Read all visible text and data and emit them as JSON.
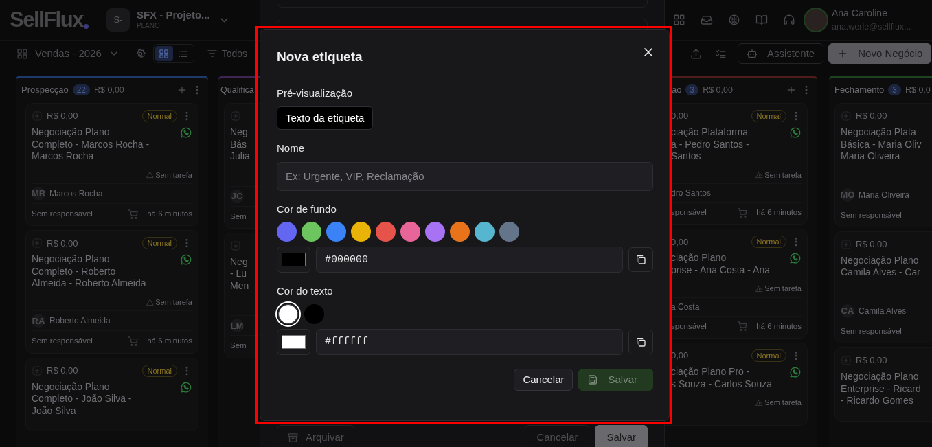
{
  "header": {
    "logo": "SellFlux",
    "workspace": {
      "initials": "S-",
      "name": "SFX - Projeto...",
      "plan": "PLANO"
    },
    "user": {
      "name": "Ana Caroline",
      "email": "ana.werle@sellflux..."
    }
  },
  "toolbar": {
    "pipeline": "Vendas - 2026",
    "views": [
      {
        "kind": "grid",
        "selected": true
      },
      {
        "kind": "list",
        "selected": false
      }
    ],
    "filter": "Todos",
    "assistant": "Assistente",
    "new_deal": "Novo Negócio"
  },
  "columns": [
    {
      "name": "Prospecção",
      "count": "22",
      "total": "R$ 0,00",
      "color": "#1e3a6b",
      "cards": [
        {
          "value": "R$ 0,00",
          "priority": "Normal",
          "title_lines": [
            "Negociação Plano",
            "Completo - Marcos Rocha -",
            "Marcos Rocha"
          ],
          "whatsapp": true,
          "task": "Sem tarefa",
          "initials": "MR",
          "contact": "Marcos Rocha",
          "owner": "Sem responsável",
          "time": "há 6 minutos"
        },
        {
          "value": "R$ 0,00",
          "priority": "Normal",
          "title_lines": [
            "Negociação Plano",
            "Completo - Roberto",
            "Almeida - Roberto Almeida"
          ],
          "whatsapp": true,
          "task": "Sem tarefa",
          "initials": "RA",
          "contact": "Roberto Almeida",
          "owner": "Sem responsável",
          "time": "há 6 minutos"
        },
        {
          "value": "R$ 0,00",
          "priority": "Normal",
          "title_lines": [
            "Negociação Plano",
            "Completo - João Silva -",
            "João Silva"
          ],
          "whatsapp": true
        }
      ]
    },
    {
      "name": "Qualifica",
      "color": "#3f2352",
      "cards": [
        {
          "title_lines": [
            "Neg",
            "Bás",
            "Julia"
          ],
          "initials": "JC",
          "owner": "Sem"
        },
        {
          "title_lines": [
            "Neg",
            "- Lu",
            "Men"
          ],
          "initials": "LM",
          "owner": "Sem"
        }
      ]
    },
    {
      "name": "ão",
      "count": "3",
      "total": "R$ 0,00",
      "color": "#4f1c1c",
      "cards": [
        {
          "value": "0,00",
          "priority": "Normal",
          "title_lines": [
            "ciação Plataforma",
            "a - Pedro Santos -",
            "Santos"
          ],
          "whatsapp": true,
          "task": "Sem tarefa",
          "contact": "dro Santos",
          "owner": "sponsável",
          "time": "há 6 minutos"
        },
        {
          "value": "0,00",
          "priority": "Normal",
          "title_lines": [
            "ciação Plano",
            "prise - Ana Costa - Ana"
          ],
          "whatsapp": true,
          "task": "Sem tarefa",
          "contact": "a Costa",
          "owner": "sponsável",
          "time": "há 6 minutos"
        },
        {
          "value": "0,00",
          "priority": "Normal",
          "title_lines": [
            "ciação Plano Pro -",
            "s Souza - Carlos Souza"
          ],
          "whatsapp": true,
          "task": "Sem tarefa"
        }
      ]
    },
    {
      "name": "Fechamento",
      "count": "3",
      "total": "R$ 0,0",
      "color": "#1d4220",
      "cards": [
        {
          "value": "R$ 0,00",
          "title_lines": [
            "Negociação Plata",
            "Básica - Maria Oliv",
            "Maria Oliveira"
          ],
          "initials": "MO",
          "contact": "Maria Oliveira",
          "owner": "Sem responsável"
        },
        {
          "value": "R$ 0,00",
          "title_lines": [
            "Negociação Plano",
            "Camila Alves - Car"
          ],
          "initials": "CA",
          "contact": "Camila Alves",
          "owner": "Sem responsável"
        },
        {
          "value": "R$ 0,00",
          "title_lines": [
            "Negociação Plano",
            "Enterprise - Ricard",
            "- Ricardo Gomes"
          ]
        }
      ]
    }
  ],
  "drawer": {
    "archive": "Arquivar",
    "cancel": "Cancelar",
    "save": "Salvar"
  },
  "modal": {
    "title": "Nova etiqueta",
    "preview_label": "Pré-visualização",
    "preview_text": "Texto da etiqueta",
    "name_label": "Nome",
    "name_placeholder": "Ex: Urgente, VIP, Reclamação",
    "background": {
      "label": "Cor de fundo",
      "hex": "#000000",
      "swatches": [
        {
          "color": "#6366f1",
          "selected": false
        },
        {
          "color": "#6cc55f",
          "selected": false
        },
        {
          "color": "#3b82f6",
          "selected": false
        },
        {
          "color": "#eab308",
          "selected": false
        },
        {
          "color": "#e5534b",
          "selected": false
        },
        {
          "color": "#e8659a",
          "selected": false
        },
        {
          "color": "#a872f4",
          "selected": false
        },
        {
          "color": "#e8731a",
          "selected": false
        },
        {
          "color": "#56b6cf",
          "selected": false
        },
        {
          "color": "#64748b",
          "selected": false
        }
      ]
    },
    "text_color": {
      "label": "Cor do texto",
      "hex": "#ffffff",
      "swatches": [
        {
          "color": "#ffffff",
          "selected": true
        },
        {
          "color": "#000000",
          "selected": false
        }
      ]
    },
    "cancel": "Cancelar",
    "save": {
      "label": "Salvar",
      "disabled": true
    }
  }
}
